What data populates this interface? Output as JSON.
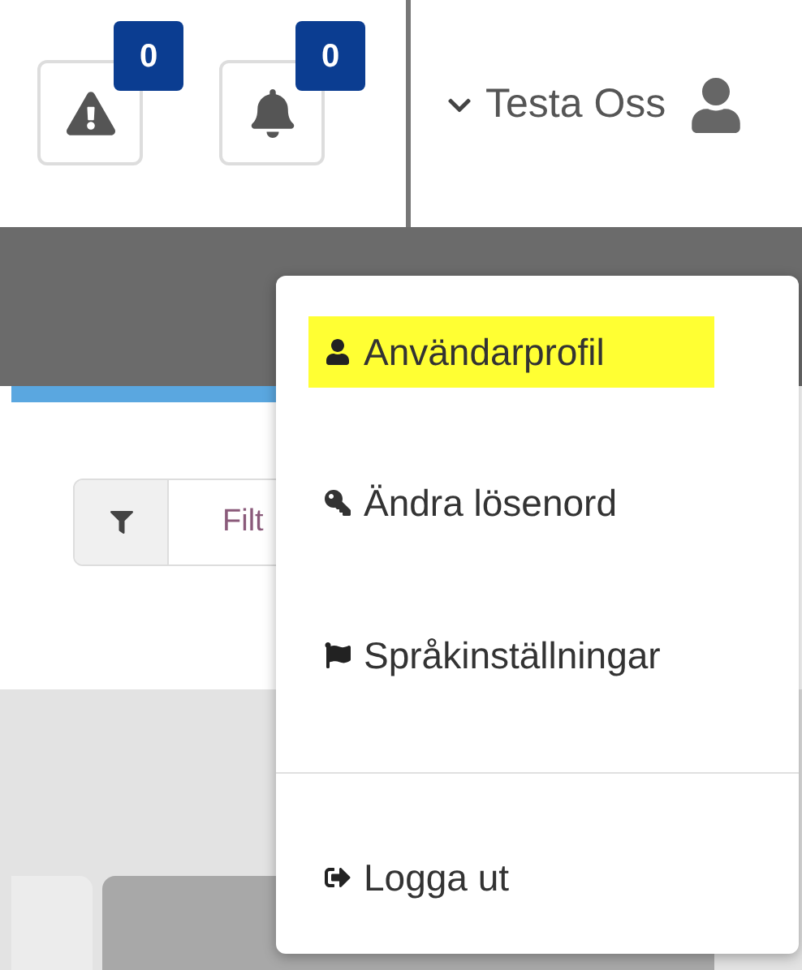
{
  "header": {
    "alerts": [
      {
        "kind": "warning",
        "count": "0"
      },
      {
        "kind": "bell",
        "count": "0"
      }
    ],
    "user": {
      "name": "Testa Oss",
      "expanded": true
    }
  },
  "filter": {
    "text": "Filt"
  },
  "menu": {
    "items": [
      {
        "kind": "profile",
        "label": "Användarprofil",
        "highlighted": true
      },
      {
        "kind": "password",
        "label": "Ändra lösenord",
        "highlighted": false
      },
      {
        "kind": "language",
        "label": "Språkinställningar",
        "highlighted": false
      }
    ],
    "footer_items": [
      {
        "kind": "logout",
        "label": "Logga ut",
        "highlighted": false
      }
    ]
  }
}
